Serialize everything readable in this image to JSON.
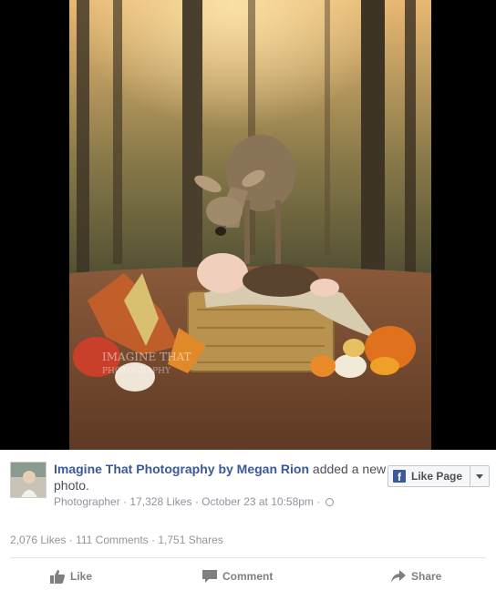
{
  "post": {
    "photo_alt": "",
    "page_name": "Imagine That Photography by Megan Rion",
    "action_text": "added a new photo.",
    "category": "Photographer",
    "likes_count": "17,328 Likes",
    "date": "October 23 at 10:58pm",
    "separator": "·",
    "audience_icon": "globe-icon"
  },
  "like_page_button": {
    "label": "Like Page",
    "icon": "facebook-logo-icon",
    "dropdown_icon": "caret-down-icon"
  },
  "stats": {
    "likes": "2,076 Likes",
    "comments": "111 Comments",
    "shares": "1,751 Shares",
    "separator": "·"
  },
  "actions": {
    "like": "Like",
    "comment": "Comment",
    "share": "Share"
  },
  "colors": {
    "brand": "#3b5998",
    "muted": "#90949c",
    "action": "#7f7f7f"
  }
}
